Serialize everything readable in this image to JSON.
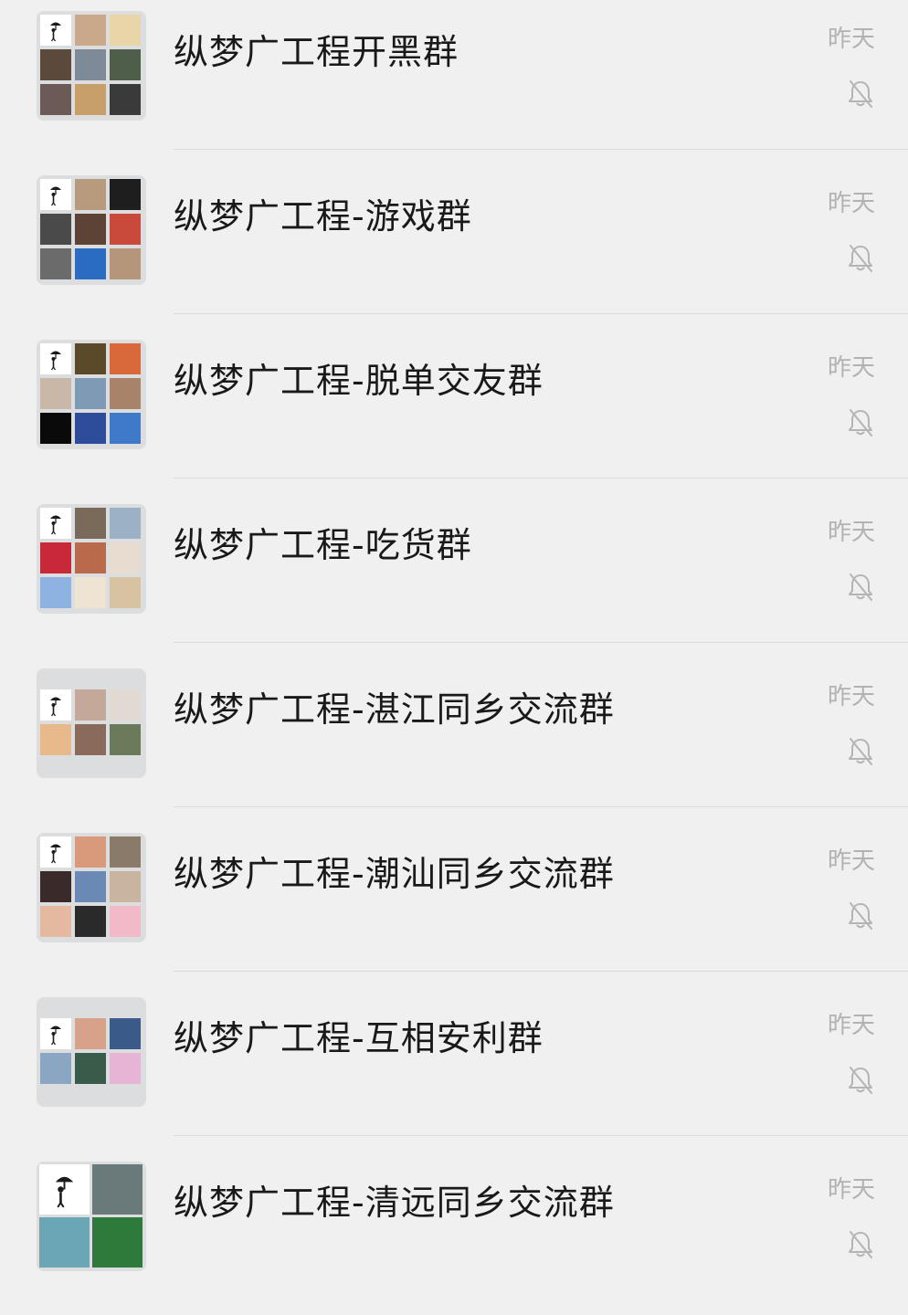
{
  "chats": [
    {
      "name": "纵梦广工程开黑群",
      "time": "昨天",
      "muted_icon": "bell-off-icon",
      "avatar_tiles": [
        "#ffffff",
        "#c9a98a",
        "#e9d6a8",
        "#5b4a3c",
        "#7f8a99",
        "#4f5e4a",
        "#6b5a55",
        "#c89e6a",
        "#3a3a3a"
      ]
    },
    {
      "name": "纵梦广工程-游戏群",
      "time": "昨天",
      "muted_icon": "bell-off-icon",
      "avatar_tiles": [
        "#ffffff",
        "#b89a7c",
        "#1e1e1e",
        "#4a4a4a",
        "#5c4336",
        "#c94a3a",
        "#6b6b6b",
        "#2a6cc2",
        "#b6967a"
      ]
    },
    {
      "name": "纵梦广工程-脱单交友群",
      "time": "昨天",
      "muted_icon": "bell-off-icon",
      "avatar_tiles": [
        "#ffffff",
        "#5a4a2a",
        "#d9683a",
        "#c9b7a8",
        "#7e9ab5",
        "#a9826a",
        "#0a0a0a",
        "#2d4d9a",
        "#3e7ac8"
      ]
    },
    {
      "name": "纵梦广工程-吃货群",
      "time": "昨天",
      "muted_icon": "bell-off-icon",
      "avatar_tiles": [
        "#ffffff",
        "#7a6a5a",
        "#9cb1c6",
        "#c8283a",
        "#b86a4a",
        "#e7dccf",
        "#8db3e3",
        "#efe3d3",
        "#d7c2a2"
      ]
    },
    {
      "name": "纵梦广工程-湛江同乡交流群",
      "time": "昨天",
      "muted_icon": "bell-off-icon",
      "avatar_tiles": [
        "#ffffff",
        "#c4a89a",
        "#e2dad2",
        "#e8b98a",
        "#8a6a5a",
        "#6a7a5a"
      ]
    },
    {
      "name": "纵梦广工程-潮汕同乡交流群",
      "time": "昨天",
      "muted_icon": "bell-off-icon",
      "avatar_tiles": [
        "#ffffff",
        "#d89a7a",
        "#8a7a6a",
        "#3a2a2a",
        "#6a8ab5",
        "#c9b4a0",
        "#e5b8a0",
        "#2a2a2a",
        "#f2b9c9"
      ]
    },
    {
      "name": "纵梦广工程-互相安利群",
      "time": "昨天",
      "muted_icon": "bell-off-icon",
      "avatar_tiles": [
        "#ffffff",
        "#d8a28a",
        "#3a5a8a",
        "#8aa6c2",
        "#3a5a4a",
        "#e6b4d4"
      ]
    },
    {
      "name": "纵梦广工程-清远同乡交流群",
      "time": "昨天",
      "muted_icon": "bell-off-icon",
      "avatar_tiles": [
        "#ffffff",
        "#6a7a7a",
        "#6aa6b5",
        "#2e7a3a"
      ]
    }
  ]
}
